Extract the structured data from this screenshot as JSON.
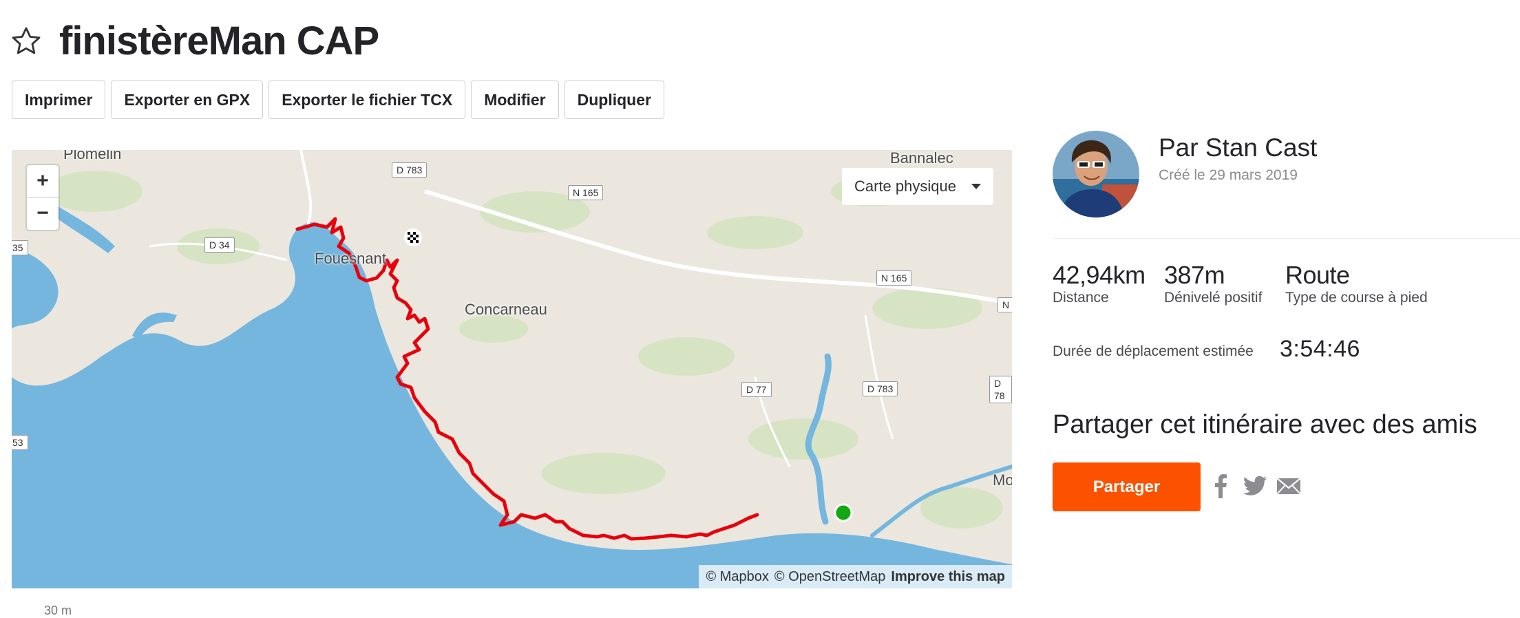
{
  "route": {
    "title": "finistèreMan CAP"
  },
  "toolbar": {
    "print": "Imprimer",
    "export_gpx": "Exporter en GPX",
    "export_tcx": "Exporter le fichier TCX",
    "edit": "Modifier",
    "duplicate": "Dupliquer"
  },
  "map": {
    "zoom_in": "+",
    "zoom_out": "−",
    "layer": "Carte physique",
    "places": {
      "plomelin": "Plomelin",
      "fouesnant": "Fouesnant",
      "concarneau": "Concarneau",
      "bannalec": "Bannalec",
      "moelan": "Mo"
    },
    "roads": {
      "d783_north": "D 783",
      "n165_a": "N 165",
      "d34": "D 34",
      "n165_b": "N 165",
      "n_edge": "N",
      "d77": "D 77",
      "d783_east": "D 783",
      "d78_edge": "D 78",
      "r35": "35",
      "r53": "53"
    },
    "attribution": {
      "mapbox": "© Mapbox",
      "osm": "© OpenStreetMap",
      "improve": "Improve this map"
    },
    "colors": {
      "water": "#75b6de",
      "land": "#ebe7df",
      "route": "#e8000b",
      "start": "#11a811"
    }
  },
  "athlete": {
    "name": "Par Stan Cast",
    "created": "Créé le 29 mars 2019"
  },
  "stats": {
    "distance": {
      "value": "42,94km",
      "label": "Distance"
    },
    "elevation": {
      "value": "387m",
      "label": "Dénivelé positif"
    },
    "type": {
      "value": "Route",
      "label": "Type de course à pied"
    }
  },
  "duration": {
    "label": "Durée de déplacement estimée",
    "value": "3:54:46"
  },
  "share": {
    "title": "Partager cet itinéraire avec des amis",
    "button": "Partager",
    "icons": [
      "facebook-icon",
      "twitter-icon",
      "email-icon"
    ]
  },
  "elevation_chart": {
    "axis_label": "30 m"
  },
  "accent_color": "#fc5200"
}
